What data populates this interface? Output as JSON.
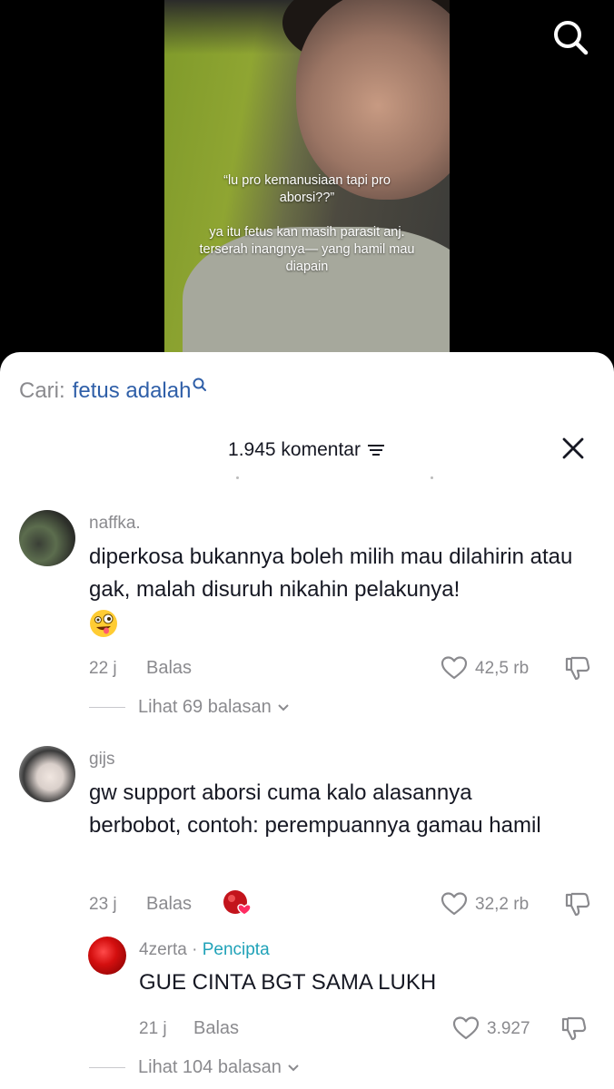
{
  "video": {
    "caption_line_1": "“lu pro kemanusiaan tapi pro aborsi??”",
    "caption_line_2": "ya itu fetus kan masih parasit anj. terserah inangnya— yang hamil mau diapain"
  },
  "search": {
    "prefix": "Cari:",
    "term": "fetus adalah"
  },
  "header": {
    "comment_count": "1.945 komentar"
  },
  "comments": [
    {
      "username": "naffka.",
      "text": "diperkosa bukannya boleh milih mau dilahirin atau gak, malah disuruh nikahin pelakunya!",
      "emoji": "zany-face",
      "time": "22 j",
      "reply_label": "Balas",
      "likes": "42,5 rb",
      "view_replies": "Lihat 69 balasan"
    },
    {
      "username": "gijs",
      "text": "gw support aborsi cuma kalo alasannya berbobot, contoh: perempuannya gamau hamil",
      "time": "23 j",
      "reply_label": "Balas",
      "likes": "32,2 rb",
      "creator_liked": true,
      "replies": [
        {
          "username": "4zerta",
          "separator": "·",
          "badge": "Pencipta",
          "text": "GUE CINTA BGT SAMA LUKH",
          "time": "21 j",
          "reply_label": "Balas",
          "likes": "3.927"
        }
      ],
      "view_replies": "Lihat 104 balasan"
    }
  ],
  "colors": {
    "creator_badge": "#20a2b8",
    "search_term": "#2f5fa8",
    "muted_text": "#8a8a8e"
  }
}
